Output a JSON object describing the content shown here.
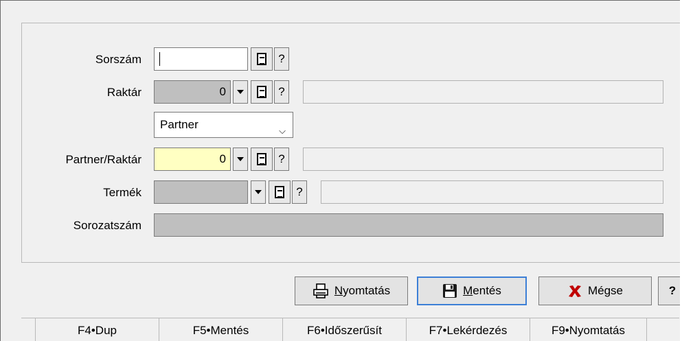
{
  "form": {
    "sorszam_label": "Sorszám",
    "raktar_label": "Raktár",
    "raktar_value": "0",
    "partner_type_select": "Partner",
    "partner_raktar_label": "Partner/Raktár",
    "partner_raktar_value": "0",
    "termek_label": "Termék",
    "sorozatszam_label": "Sorozatszám",
    "question": "?"
  },
  "buttons": {
    "print": "Nyomtatás",
    "print_mnemonic": "N",
    "save": "Mentés",
    "save_mnemonic": "M",
    "cancel": "Mégse",
    "help": "?"
  },
  "fkeys": [
    "F4•Dup",
    "F5•Mentés",
    "F6•Időszerűsít",
    "F7•Lekérdezés",
    "F9•Nyomtatás"
  ]
}
